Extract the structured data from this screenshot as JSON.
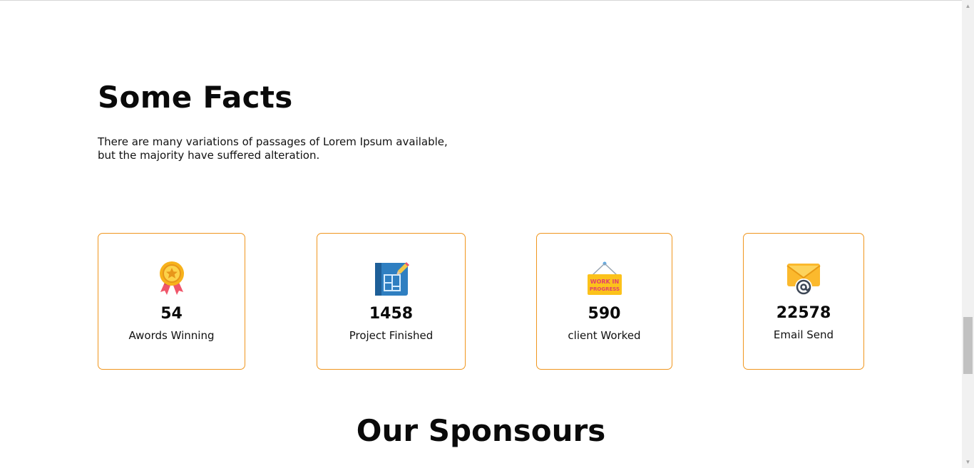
{
  "facts": {
    "title": "Some Facts",
    "description_line1": "There are many variations of passages of Lorem Ipsum available,",
    "description_line2": "but the majority have suffered alteration."
  },
  "stats": [
    {
      "icon": "award-medal-icon",
      "value": "54",
      "label": "Awords Winning"
    },
    {
      "icon": "blueprint-icon",
      "value": "1458",
      "label": "Project Finished"
    },
    {
      "icon": "work-in-progress-sign-icon",
      "value": "590",
      "label": "client Worked",
      "sign_text_1": "WORK IN",
      "sign_text_2": "PROGRESS"
    },
    {
      "icon": "email-envelope-icon",
      "value": "22578",
      "label": "Email Send"
    }
  ],
  "sponsors": {
    "title": "Our Sponsours"
  },
  "colors": {
    "card_border": "#f0961e",
    "medal": "#f7b21b",
    "ribbon": "#f0566a",
    "blueprint": "#2f7fc1",
    "sign": "#fcc21b",
    "envelope": "#fbb92d"
  }
}
